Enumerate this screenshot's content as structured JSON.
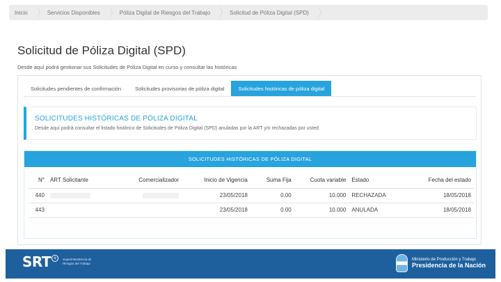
{
  "breadcrumb": [
    "Inicio",
    "Servicios Disponibles",
    "Póliza Digital de Riesgos del Trabajo",
    "Solicitud de Póliza Digital (SPD)"
  ],
  "page": {
    "title": "Solicitud de Póliza Digital (SPD)",
    "subtitle": "Desde aquí podrá gestionar sus Solicitudes de Póliza Digital en curso y consultar las históricas"
  },
  "tabs": [
    {
      "label": "Solicitudes pendientes de confirmación",
      "active": false
    },
    {
      "label": "Solicitudes provisorias de póliza digital",
      "active": false
    },
    {
      "label": "Solicitudes históricas de póliza digital",
      "active": true
    }
  ],
  "info": {
    "title": "SOLICITUDES HISTÓRICAS DE PÓLIZA DIGITAL",
    "text": "Desde aquí podrá consultar el listado histórico de Solicitudes de Póliza Digital (SPD) anuladas por la ART y/o rechazadas por usted."
  },
  "table": {
    "title": "SOLICITUDES HISTÓRICAS DE PÓLIZA DIGITAL",
    "columns": [
      "N°",
      "ART Solicitante",
      "Comercializador",
      "Inicio de Vigencia",
      "Suma Fija",
      "Cuota variable",
      "Estado",
      "Fecha del estado"
    ],
    "rows": [
      {
        "n": "440",
        "art": "",
        "comercializador": "",
        "inicio": "23/05/2018",
        "suma": "0.00",
        "cuota": "10.000",
        "estado": "RECHAZADA",
        "fecha": "18/05/2018"
      },
      {
        "n": "443",
        "art": "",
        "comercializador": "",
        "inicio": "23/05/2018",
        "suma": "0.00",
        "cuota": "10.000",
        "estado": "ANULADA",
        "fecha": "18/05/2018"
      }
    ]
  },
  "footer": {
    "logo": "SRT",
    "logo_sub": [
      "Superintendencia de",
      "Riesgos del Trabajo"
    ],
    "gov_line1": "Ministerio de Producción y Trabajo",
    "gov_line2": "Presidencia de la Nación"
  },
  "colors": {
    "accent": "#27a3dd",
    "footer": "#1e5f9e"
  }
}
